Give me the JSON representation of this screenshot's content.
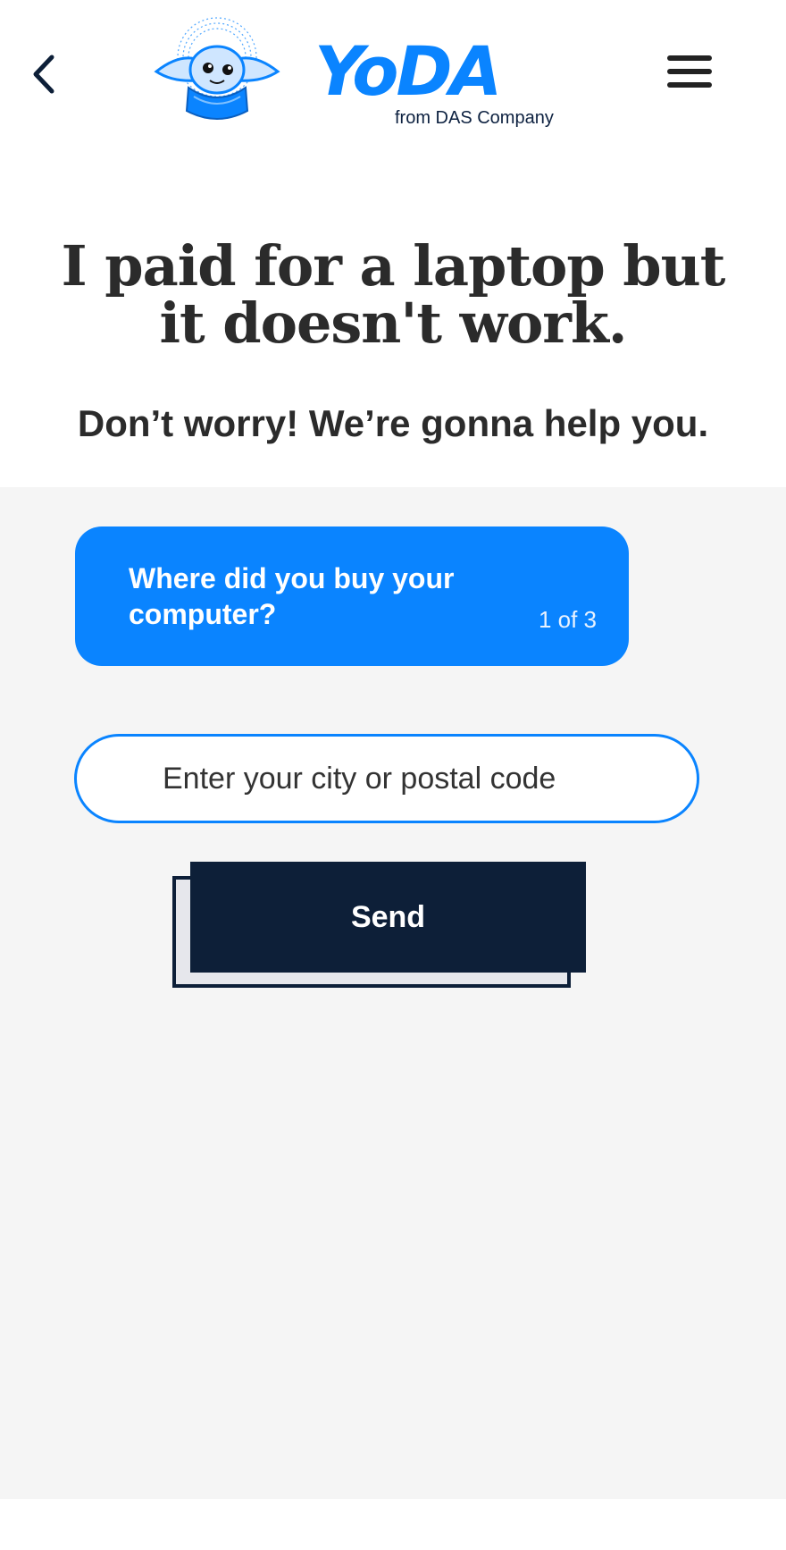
{
  "header": {
    "brand_name": "YoDA",
    "brand_sub": "from DAS Company",
    "back_icon": "chevron-left-icon",
    "menu_icon": "hamburger-menu-icon"
  },
  "hero": {
    "title_line1": "I paid for a laptop but",
    "title_line2": "it doesn't work.",
    "subtitle": "Don’t worry! We’re gonna help you."
  },
  "question": {
    "text": "Where did you buy your computer?",
    "step": "1 of 3"
  },
  "form": {
    "city_placeholder": "Enter your city or postal code",
    "city_value": "",
    "send_label": "Send"
  },
  "colors": {
    "accent": "#0a84ff",
    "dark": "#0d1f38",
    "page_bg": "#f5f5f5"
  }
}
